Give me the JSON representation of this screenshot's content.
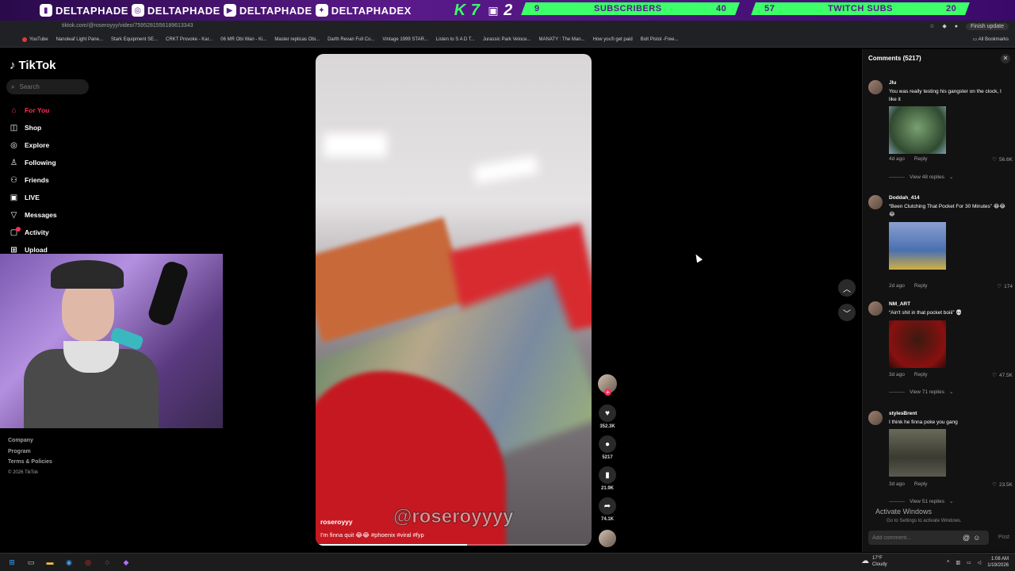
{
  "overlay": {
    "social": [
      {
        "icon": "twitch-icon",
        "label": "DELTAPHADE"
      },
      {
        "icon": "instagram-icon",
        "label": "DELTAPHADE"
      },
      {
        "icon": "youtube-icon",
        "label": "DELTAPHADE"
      },
      {
        "icon": "twitter-icon",
        "label": "DELTAPHADEX"
      }
    ],
    "k_label": "K",
    "k_count": "7",
    "streams": "2",
    "subscribers": {
      "current": "9",
      "label": "SUBSCRIBERS",
      "goal": "40",
      "progress": 0.225
    },
    "twitch_subs": {
      "current": "57",
      "label": "TWITCH SUBS",
      "goal": "20",
      "progress": 1.0
    }
  },
  "browser": {
    "url": "tiktok.com/@roseroyyy/video/7595281556189613343",
    "refresh_label": "Finish update",
    "bookmarks": [
      "YouTube",
      "Nanoleaf Light Pane...",
      "Stark Equipment SE...",
      "CRKT Provoke - Kar...",
      "06 MR Obi Wan - Ki...",
      "Master replicas Obi...",
      "Darth Revan Full Co...",
      "Vintage 1999 STAR...",
      "Listen to S A D T...",
      "Jurassic Park Veloce...",
      "MANATY : The Man...",
      "How you'll get paid",
      "Bolt Pistol -Free..."
    ],
    "all_bookmarks": "All Bookmarks"
  },
  "sidebar": {
    "logo": "TikTok",
    "search_placeholder": "Search",
    "nav": [
      {
        "label": "For You",
        "icon": "home-icon",
        "active": true
      },
      {
        "label": "Shop",
        "icon": "shop-icon",
        "active": false
      },
      {
        "label": "Explore",
        "icon": "compass-icon",
        "active": false
      },
      {
        "label": "Following",
        "icon": "following-icon",
        "active": false
      },
      {
        "label": "Friends",
        "icon": "friends-icon",
        "active": false
      },
      {
        "label": "LIVE",
        "icon": "live-icon",
        "active": false
      },
      {
        "label": "Messages",
        "icon": "messages-icon",
        "active": false
      },
      {
        "label": "Activity",
        "icon": "activity-icon",
        "active": false
      },
      {
        "label": "Upload",
        "icon": "upload-icon",
        "active": false
      }
    ],
    "footer": {
      "company": "Company",
      "program": "Program",
      "terms": "Terms & Policies",
      "copyright": "© 2026 TikTok"
    }
  },
  "video": {
    "username": "roseroyyy",
    "watermark": "@roseroyyyy",
    "caption": "I'm finna quit 😂😂 #phoenix #viral #fyp",
    "progress": 0.55
  },
  "actions": {
    "likes": "352.3K",
    "comments": "5217",
    "saves": "21.9K",
    "shares": "74.1K"
  },
  "comments": {
    "title": "Comments",
    "count": "(5217)",
    "items": [
      {
        "user": "Jlu",
        "text": "You was really testing his gangster on the clock, I like it",
        "time": "4d ago",
        "reply": "Reply",
        "likes": "56.6K",
        "view_replies": "View 48 replies"
      },
      {
        "user": "Doddah_414",
        "text": "“Been Clutching That Pocket For 30 Minutes” 😂😂😂",
        "time": "2d ago",
        "reply": "Reply",
        "likes": "174",
        "view_replies": ""
      },
      {
        "user": "NM_ART",
        "text": "“Ain't shit in that pocket boiii” 💀",
        "time": "3d ago",
        "reply": "Reply",
        "likes": "47.5K",
        "view_replies": "View 71 replies"
      },
      {
        "user": "stylesBrent",
        "text": "I think he finna poke you gang",
        "time": "3d ago",
        "reply": "Reply",
        "likes": "23.5K",
        "view_replies": "View 51 replies"
      }
    ],
    "add_placeholder": "Add comment...",
    "post_label": "Post"
  },
  "windows": {
    "activate_title": "Activate Windows",
    "activate_sub": "Go to Settings to activate Windows.",
    "weather_temp": "17°F",
    "weather_desc": "Cloudy",
    "time": "1:08 AM",
    "date": "1/19/2026"
  }
}
